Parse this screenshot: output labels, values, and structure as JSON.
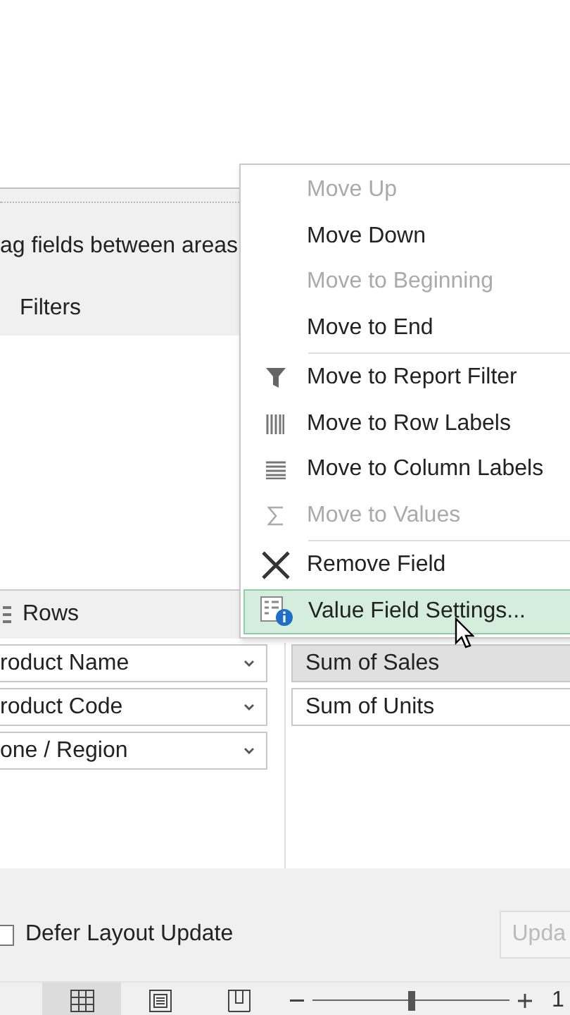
{
  "panel": {
    "hint": "ag fields between areas",
    "filters_label": "Filters",
    "rows_label": "Rows"
  },
  "rows": [
    {
      "label": "roduct Name"
    },
    {
      "label": "roduct Code"
    },
    {
      "label": "one / Region"
    }
  ],
  "values": [
    {
      "label": "Sum of Sales",
      "selected": true
    },
    {
      "label": "Sum of Units",
      "selected": false
    }
  ],
  "context_menu": {
    "items": [
      {
        "kind": "item",
        "label": "Move Up",
        "disabled": true,
        "selected": false
      },
      {
        "kind": "item",
        "label": "Move Down",
        "disabled": false,
        "selected": false
      },
      {
        "kind": "item",
        "label": "Move to Beginning",
        "disabled": true,
        "selected": false
      },
      {
        "kind": "item",
        "label": "Move to End",
        "disabled": false,
        "selected": false
      },
      {
        "kind": "separator"
      },
      {
        "kind": "item",
        "label": "Move to Report Filter",
        "disabled": false,
        "selected": false
      },
      {
        "kind": "item",
        "label": "Move to Row Labels",
        "disabled": false,
        "selected": false
      },
      {
        "kind": "item",
        "label": "Move to Column Labels",
        "disabled": false,
        "selected": false
      },
      {
        "kind": "item",
        "label": "Move to Values",
        "disabled": true,
        "selected": false
      },
      {
        "kind": "separator"
      },
      {
        "kind": "item",
        "label": "Remove Field",
        "disabled": false,
        "selected": false
      },
      {
        "kind": "item",
        "label": "Value Field Settings...",
        "disabled": false,
        "selected": true
      }
    ]
  },
  "footer": {
    "defer_label": "Defer Layout Update",
    "defer_checked": false,
    "update_label": "Upda",
    "update_disabled": true
  },
  "status_bar": {
    "views": [
      {
        "selected": true
      },
      {
        "selected": false
      },
      {
        "selected": false
      }
    ],
    "zoom": {
      "level": 0.5
    },
    "zoom_text": "1"
  }
}
